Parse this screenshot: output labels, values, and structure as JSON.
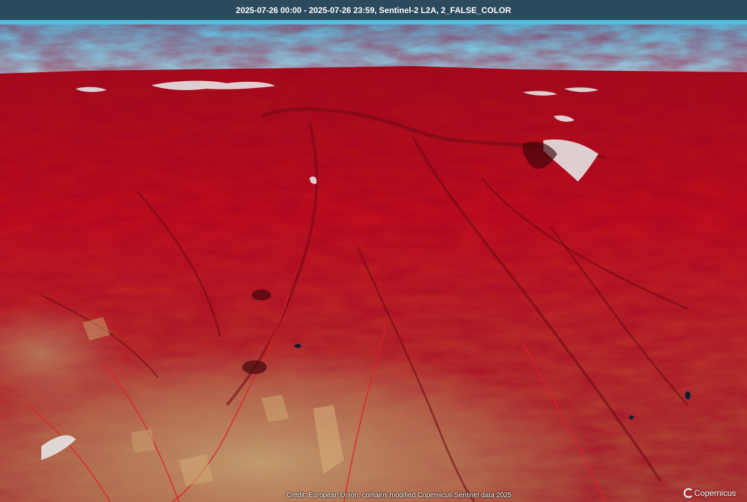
{
  "header": {
    "title": "2025-07-26 00:00 - 2025-07-26 23:59, Sentinel-2 L2A, 2_FALSE_COLOR"
  },
  "footer": {
    "credit": "Credit: European Union, contains modified Copernicus Sentinel data 2025",
    "logo_text": "Copernicus"
  },
  "colors": {
    "sky_top": "#5fc6e6",
    "sky_bottom": "#a9e4f2",
    "vegetation_red": "#c8121f",
    "dark_red": "#7a0c14",
    "soil_tan": "#b48b63",
    "snow": "#e6e6e6"
  }
}
